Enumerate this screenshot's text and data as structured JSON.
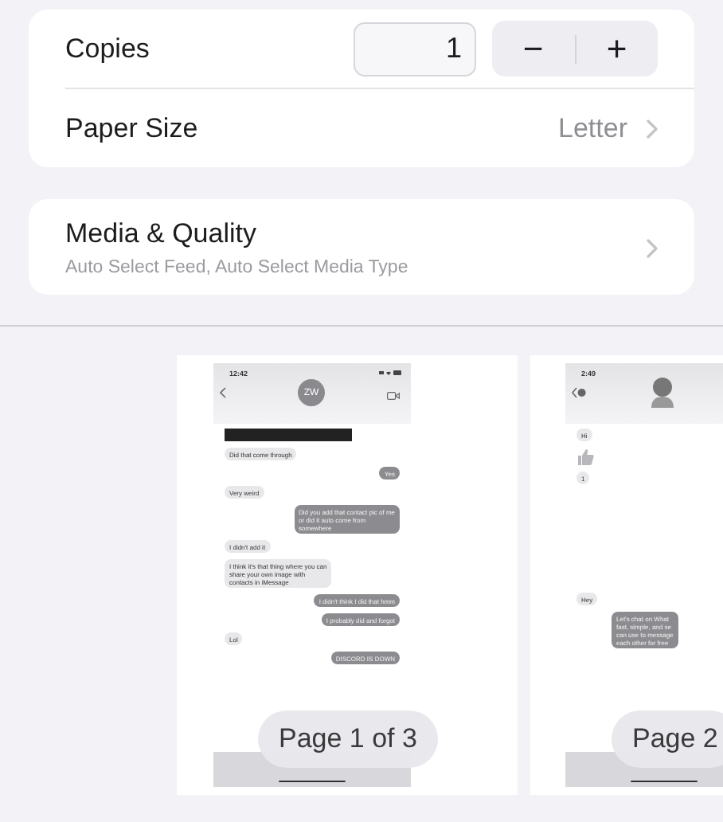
{
  "copies": {
    "label": "Copies",
    "value": "1",
    "decrement": "−",
    "increment": "+"
  },
  "paper_size": {
    "label": "Paper Size",
    "value": "Letter"
  },
  "media_quality": {
    "title": "Media & Quality",
    "subtitle": "Auto Select Feed, Auto Select Media Type"
  },
  "pages": [
    {
      "overlay": "Page 1 of 3",
      "header": {
        "kind": "initials",
        "time": "12:42",
        "avatar": "ZW"
      },
      "messages": [
        {
          "kind": "attachment"
        },
        {
          "kind": "received",
          "lines": [
            "Did that come through"
          ]
        },
        {
          "kind": "sent",
          "lines": [
            "Yes"
          ]
        },
        {
          "kind": "received",
          "lines": [
            "Very weird"
          ]
        },
        {
          "kind": "sent",
          "lines": [
            "Did you add that contact pic of me",
            "or did it auto come from",
            "somewhere"
          ]
        },
        {
          "kind": "received",
          "lines": [
            "I didn't add it"
          ]
        },
        {
          "kind": "received",
          "lines": [
            "I think it's that thing where you can",
            "share your own image with",
            "contacts in iMessage"
          ]
        },
        {
          "kind": "sent",
          "lines": [
            "I didn't think I did that hmm"
          ]
        },
        {
          "kind": "sent",
          "lines": [
            "I probably did and forgot"
          ]
        },
        {
          "kind": "received",
          "lines": [
            "Lol"
          ]
        },
        {
          "kind": "sent",
          "lines": [
            "DISCORD IS DOWN"
          ]
        }
      ]
    },
    {
      "overlay": "Page 2",
      "header": {
        "kind": "figure",
        "time": "2:49"
      },
      "messages": [
        {
          "kind": "received",
          "lines": [
            "Hi"
          ]
        },
        {
          "kind": "thumbs"
        },
        {
          "kind": "received",
          "lines": [
            "1"
          ]
        },
        {
          "kind": "spacer"
        },
        {
          "kind": "received",
          "lines": [
            "Hey"
          ]
        },
        {
          "kind": "sent",
          "lines": [
            "Let's chat on What",
            "fast, simple, and se",
            "can use to message",
            "each other for free"
          ]
        }
      ]
    }
  ]
}
